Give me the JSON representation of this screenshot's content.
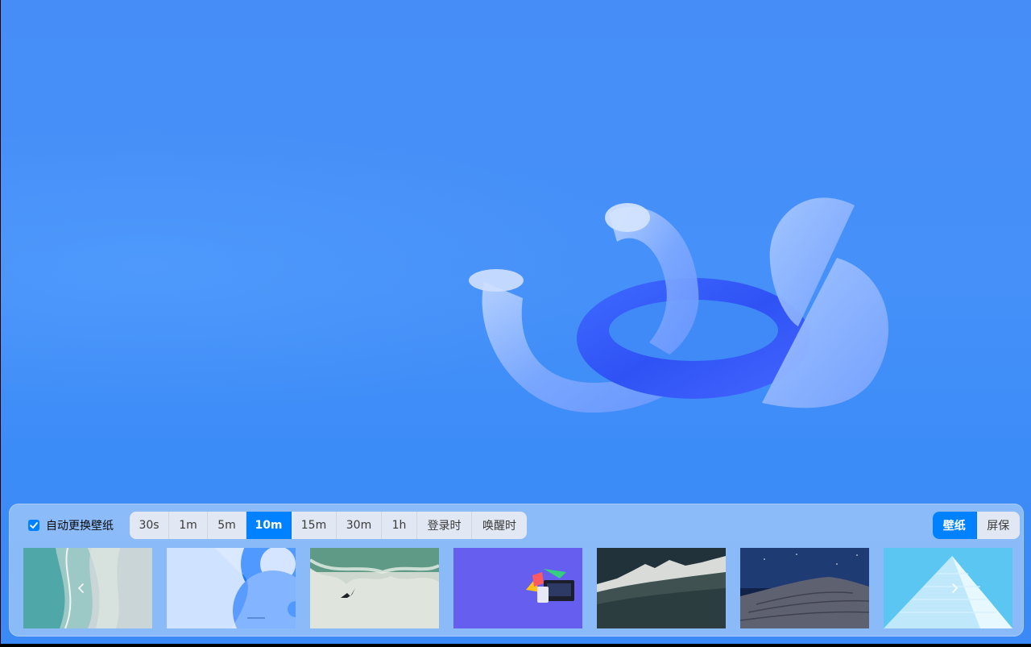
{
  "panel": {
    "auto_change": {
      "label": "自动更换壁纸",
      "checked": true
    },
    "intervals": [
      {
        "label": "30s",
        "active": false
      },
      {
        "label": "1m",
        "active": false
      },
      {
        "label": "5m",
        "active": false
      },
      {
        "label": "10m",
        "active": true
      },
      {
        "label": "15m",
        "active": false
      },
      {
        "label": "30m",
        "active": false
      },
      {
        "label": "1h",
        "active": false
      },
      {
        "label": "登录时",
        "active": false
      },
      {
        "label": "唤醒时",
        "active": false
      }
    ],
    "modes": [
      {
        "label": "壁纸",
        "active": true
      },
      {
        "label": "屏保",
        "active": false
      }
    ],
    "thumbnails": [
      {
        "name": "beach-aerial"
      },
      {
        "name": "blue-abstract-circles"
      },
      {
        "name": "waterfall-bird"
      },
      {
        "name": "purple-3d-devices"
      },
      {
        "name": "mountain-fog"
      },
      {
        "name": "night-desert-dune"
      },
      {
        "name": "light-blue-pyramid"
      }
    ],
    "nav": {
      "prev_icon": "chevron-left-icon",
      "next_icon": "chevron-right-icon"
    }
  },
  "colors": {
    "accent": "#0081ff",
    "desktop": "#468df8"
  }
}
